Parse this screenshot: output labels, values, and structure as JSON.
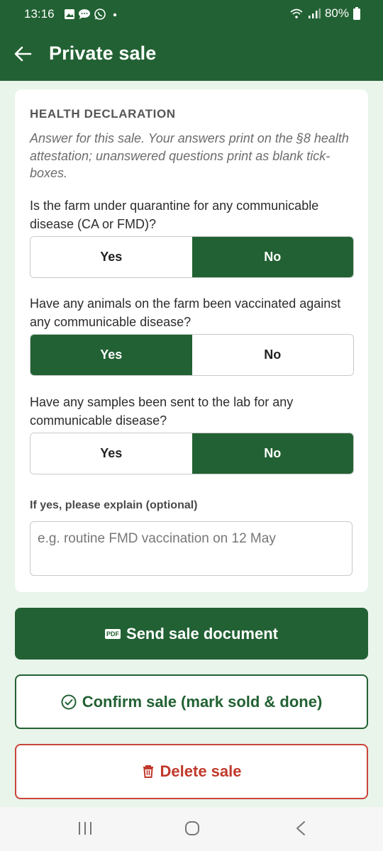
{
  "status": {
    "time": "13:16",
    "battery": "80%",
    "left_icons": [
      "gallery-icon",
      "chat-icon",
      "whatsapp-icon",
      "dot-icon"
    ],
    "right_icons": [
      "wifi-icon",
      "signal-icon",
      "battery-icon"
    ]
  },
  "appbar": {
    "title": "Private sale"
  },
  "health": {
    "title": "HEALTH DECLARATION",
    "hint": "Answer for this sale. Your answers print on the §8 health attestation; unanswered questions print as blank tick-boxes.",
    "questions": [
      {
        "text": "Is the farm under quarantine for any communicable disease (CA or FMD)?",
        "yes": "Yes",
        "no": "No",
        "selected": "No"
      },
      {
        "text": "Have any animals on the farm been vaccinated against any communicable disease?",
        "yes": "Yes",
        "no": "No",
        "selected": "Yes"
      },
      {
        "text": "Have any samples been sent to the lab for any communicable disease?",
        "yes": "Yes",
        "no": "No",
        "selected": "No"
      }
    ],
    "explain_label": "If yes, please explain (optional)",
    "explain_placeholder": "e.g. routine FMD vaccination on 12 May"
  },
  "actions": {
    "send_badge": "PDF",
    "send": "Send sale document",
    "confirm": "Confirm sale (mark sold & done)",
    "delete": "Delete sale"
  },
  "colors": {
    "primary": "#226133",
    "danger": "#c0392b",
    "background": "#e9f4ea"
  }
}
